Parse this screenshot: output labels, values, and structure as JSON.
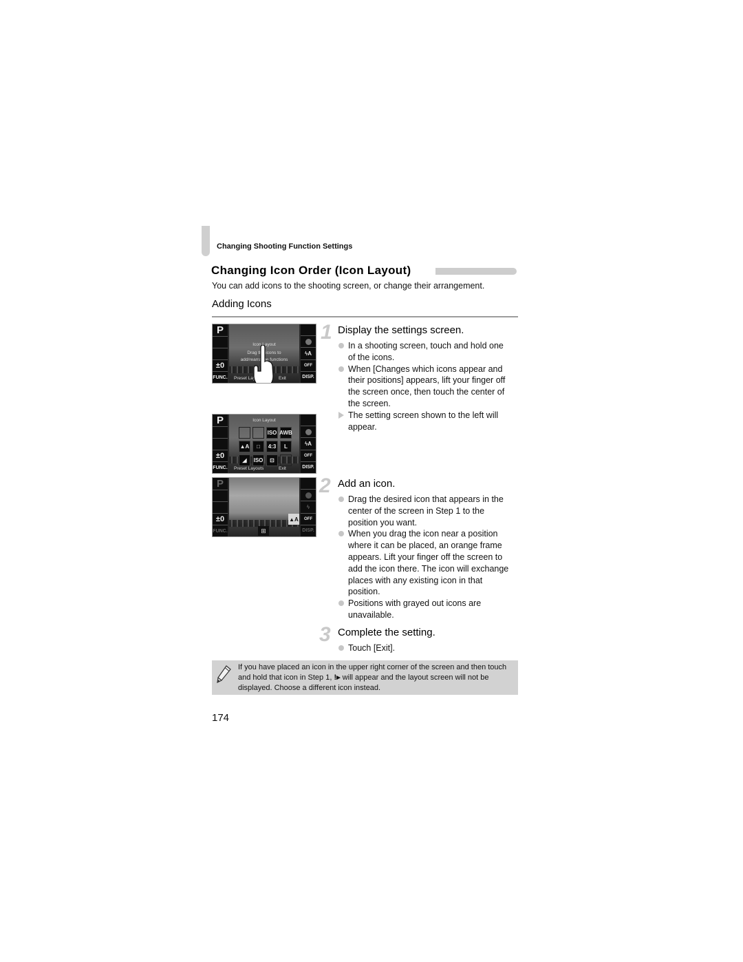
{
  "header": {
    "section_label": "Changing Shooting Function Settings",
    "title": "Changing Icon Order (Icon Layout)",
    "intro": "You can add icons to the shooting screen, or change their arrangement.",
    "subheading": "Adding Icons"
  },
  "screens": {
    "screen1": {
      "left_icons": [
        "P",
        "",
        "",
        "±0",
        "FUNC."
      ],
      "right_icons": [
        "",
        "●",
        "ϟA",
        "OFF",
        "DISP."
      ],
      "overlay_title": "Icon Layout",
      "overlay_text_line1": "Drag the icons to",
      "overlay_text_line2": "add/rearrange functions",
      "footer_left": "Preset Layouts",
      "footer_right": "Exit",
      "hand_icon": "touch-hand-icon"
    },
    "screen2": {
      "left_icons": [
        "P",
        "",
        "",
        "±0",
        "FUNC."
      ],
      "right_icons": [
        "",
        "●",
        "ϟA",
        "OFF",
        "DISP."
      ],
      "overlay_title": "Icon Layout",
      "grid_icons": [
        "",
        "",
        "ISO",
        "AWB",
        "▲A",
        "□",
        "4:3",
        "L",
        "◢",
        "ISO",
        "⊡",
        ""
      ],
      "footer_left": "Preset Layouts",
      "footer_right": "Exit"
    },
    "screen3": {
      "left_icons": [
        "P",
        "",
        "",
        "±0",
        "FUNC."
      ],
      "right_icons": [
        "",
        "●",
        "ϟ",
        "OFF",
        "DISP."
      ],
      "dragged_icon": "▲A",
      "bottom_icon": "⊞"
    }
  },
  "steps": [
    {
      "number": "1",
      "heading": "Display the settings screen.",
      "bullets": [
        {
          "type": "circle",
          "text": "In a shooting screen, touch and hold one of the icons."
        },
        {
          "type": "circle",
          "text": "When [Changes which icons appear and their positions] appears, lift your finger off the screen once, then touch the center of the screen."
        },
        {
          "type": "triangle",
          "text": "The setting screen shown to the left will appear."
        }
      ]
    },
    {
      "number": "2",
      "heading": "Add an icon.",
      "bullets": [
        {
          "type": "circle",
          "text": "Drag the desired icon that appears in the center of the screen in Step 1 to the position you want."
        },
        {
          "type": "circle",
          "text": "When you drag the icon near a position where it can be placed, an orange frame appears. Lift your finger off the screen to add the icon there. The icon will exchange places with any existing icon in that position."
        },
        {
          "type": "circle",
          "text": "Positions with grayed out icons are unavailable."
        }
      ]
    },
    {
      "number": "3",
      "heading": "Complete the setting.",
      "bullets": [
        {
          "type": "circle",
          "text": "Touch [Exit]."
        }
      ]
    }
  ],
  "note": {
    "icon": "pencil-icon",
    "text_before": "If you have placed an icon in the upper right corner of the screen and then touch and hold that icon in Step 1, ",
    "symbol": "!▸",
    "text_after": " will appear and the layout screen will not be displayed. Choose a different icon instead."
  },
  "page_number": "174"
}
